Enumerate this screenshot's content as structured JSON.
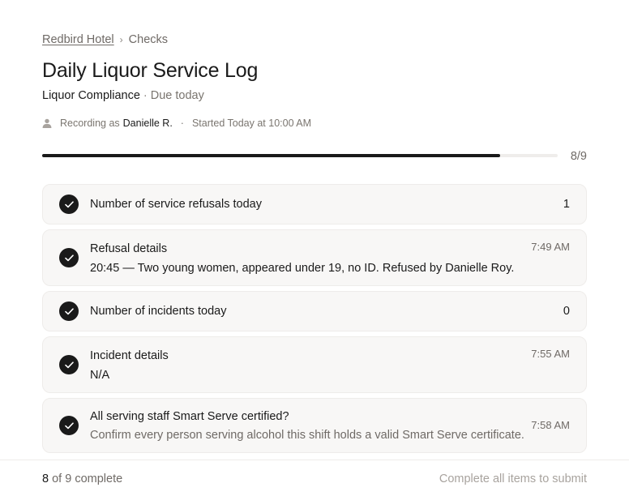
{
  "breadcrumb": {
    "hotel": "Redbird Hotel",
    "separator": "›",
    "section": "Checks"
  },
  "page": {
    "title": "Daily Liquor Service Log",
    "category": "Liquor Compliance",
    "dot": "·",
    "due": "Due today"
  },
  "meta": {
    "icon": "person-icon",
    "recording_prefix": "Recording as",
    "recorder": "Danielle R.",
    "dot": "·",
    "started": "Started Today at 10:00 AM"
  },
  "progress": {
    "completed": 8,
    "total": 9,
    "label": "8/9"
  },
  "items": [
    {
      "label": "Number of service refusals today",
      "value": "1"
    },
    {
      "label": "Refusal details",
      "detail": "20:45 — Two young women, appeared under 19, no ID. Refused by Danielle Roy.",
      "time": "7:49 AM"
    },
    {
      "label": "Number of incidents today",
      "value": "0"
    },
    {
      "label": "Incident details",
      "detail": "N/A",
      "time": "7:55 AM"
    },
    {
      "label": "All serving staff Smart Serve certified?",
      "detail": "Confirm every person serving alcohol this shift holds a valid Smart Serve certificate.",
      "time": "7:58 AM"
    }
  ],
  "footer": {
    "completed": "8",
    "summary_suffix": "of 9 complete",
    "submit_label": "Complete all items to submit"
  },
  "colors": {
    "accent": "#1a1a1a",
    "card_bg": "#f8f7f6",
    "muted_text": "#6f6a66"
  }
}
